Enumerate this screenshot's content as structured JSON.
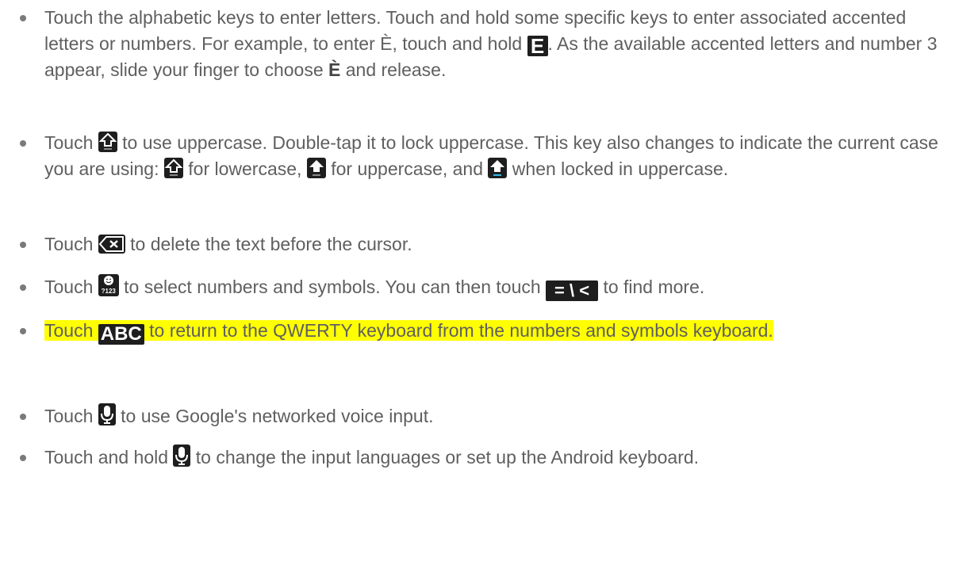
{
  "items": [
    {
      "t1": "Touch the alphabetic keys to enter letters. Touch and hold some specific keys to enter associated accented letters or numbers. For example, to enter È, touch and hold",
      "t2": ". As the available accented letters and number 3 appear, slide your finger to choose",
      "bold": "È",
      "t3": "and release.",
      "key": "E"
    },
    {
      "t1": "Touch",
      "t2": "to use uppercase. Double-tap it to lock uppercase. This key also changes to indicate the current case you are using:",
      "t3": "for lowercase,",
      "t4": "for uppercase, and",
      "t5": "when locked in uppercase."
    },
    {
      "t1": "Touch",
      "t2": "to delete the text before the cursor."
    },
    {
      "t1": "Touch",
      "key1": "?123",
      "t2": "to select numbers and symbols. You can then touch",
      "key2": "= \\ <",
      "t3": "to find more."
    },
    {
      "t1": "Touch",
      "key": "ABC",
      "t2": "to return to the QWERTY keyboard from the numbers and symbols keyboard.",
      "highlight": "#ffff00"
    },
    {
      "t1": "Touch",
      "t2": "to use Google's networked voice input."
    },
    {
      "t1": "Touch and hold",
      "t2": "to change the input languages or set up the Android keyboard."
    }
  ],
  "icons": {
    "shift_lower": "shift-outline-icon",
    "shift_upper": "shift-filled-icon",
    "shift_locked": "shift-locked-icon",
    "delete": "backspace-icon",
    "emoji_numbers": "emoji-numbers-key-icon",
    "microphone": "microphone-icon"
  },
  "colors": {
    "text": "#5f5f5f",
    "key": "#1e1e1e",
    "lock_accent": "#33b5e5"
  }
}
